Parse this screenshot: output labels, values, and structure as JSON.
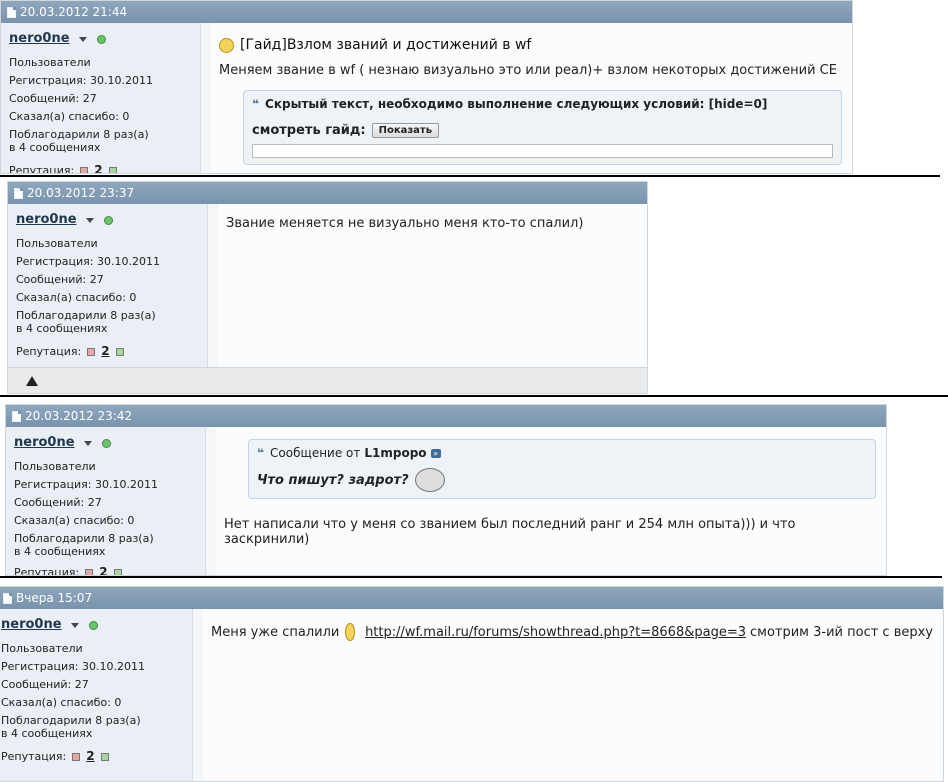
{
  "posts": [
    {
      "date": "20.03.2012 21:44",
      "user": {
        "name": "nero0ne",
        "group": "Пользователи",
        "reg": "Регистрация:   30.10.2011",
        "msgs": "Сообщений:   27",
        "thanks": "Сказал(а) спасибо:   0",
        "thanked1": "Поблагодарили 8 раз(а)",
        "thanked2": "в 4 сообщениях",
        "rep_label": "Репутация:",
        "rep_val": "2"
      },
      "title": "[Гайд]Взлом званий и достижений в wf",
      "text": "Меняем звание в wf ( незнаю визуально это или реал)+ взлом некоторых достижений CE",
      "quote_head": "Скрытый текст, необходимо выполнение следующих условий: [hide=0]",
      "guide_label": "смотреть гайд:",
      "show_btn": "Показать"
    },
    {
      "date": "20.03.2012 23:37",
      "user": {
        "name": "nero0ne",
        "group": "Пользователи",
        "reg": "Регистрация:   30.10.2011",
        "msgs": "Сообщений:   27",
        "thanks": "Сказал(а) спасибо:   0",
        "thanked1": "Поблагодарили 8 раз(а)",
        "thanked2": "в 4 сообщениях",
        "rep_label": "Репутация:",
        "rep_val": "2"
      },
      "text": "Звание меняется не визуально меня кто-то спалил)"
    },
    {
      "date": "20.03.2012 23:42",
      "user": {
        "name": "nero0ne",
        "group": "Пользователи",
        "reg": "Регистрация:   30.10.2011",
        "msgs": "Сообщений:   27",
        "thanks": "Сказал(а) спасибо:   0",
        "thanked1": "Поблагодарили 8 раз(а)",
        "thanked2": "в 4 сообщениях",
        "rep_label": "Репутация:",
        "rep_val": "2"
      },
      "quote_prefix": "Сообщение от",
      "quote_author": "L1mpopo",
      "quote_text": "Что пишут? задрот?",
      "text": "Нет написали что у меня со званием был последний ранг и 254 млн опыта))) и что заскринили)"
    },
    {
      "date": "Вчера 15:07",
      "user": {
        "name": "nero0ne",
        "group": "Пользователи",
        "reg": "Регистрация:   30.10.2011",
        "msgs": "Сообщений:   27",
        "thanks": "Сказал(а) спасибо:   0",
        "thanked1": "Поблагодарили 8 раз(а)",
        "thanked2": "в 4 сообщениях",
        "rep_label": "Репутация:",
        "rep_val": "2"
      },
      "text_before": "Меня уже спалили",
      "link": "http://wf.mail.ru/forums/showthread.php?t=8668&page=3",
      "text_after": "смотрим 3-ий пост с верху"
    }
  ]
}
